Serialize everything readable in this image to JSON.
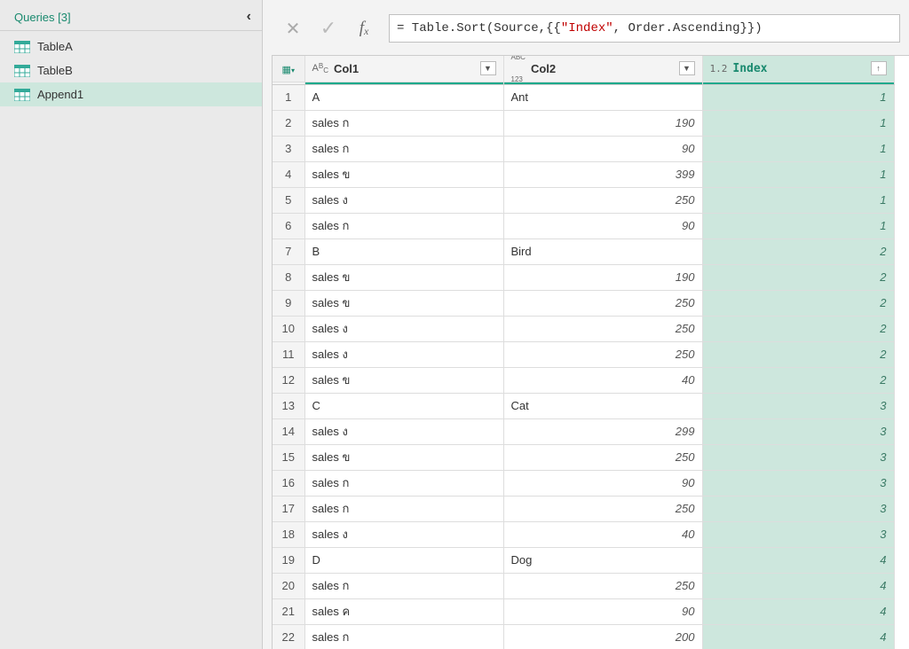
{
  "sidebar": {
    "title": "Queries [3]",
    "items": [
      {
        "label": "TableA"
      },
      {
        "label": "TableB"
      },
      {
        "label": "Append1"
      }
    ],
    "selectedIndex": 2
  },
  "formula": {
    "prefix": "= Table.Sort(Source,{{",
    "quoted": "\"Index\"",
    "suffix": ", Order.Ascending}})"
  },
  "columns": {
    "col1": {
      "type": "ABC",
      "name": "Col1"
    },
    "col2": {
      "type": "ABC123",
      "name": "Col2"
    },
    "col3": {
      "type": "1.2",
      "name": "Index",
      "sorted": "asc"
    }
  },
  "rows": [
    {
      "n": 1,
      "c1": "A",
      "c2": "Ant",
      "c2n": false,
      "idx": 1
    },
    {
      "n": 2,
      "c1": "sales ก",
      "c2": "190",
      "c2n": true,
      "idx": 1
    },
    {
      "n": 3,
      "c1": "sales ก",
      "c2": "90",
      "c2n": true,
      "idx": 1
    },
    {
      "n": 4,
      "c1": "sales ข",
      "c2": "399",
      "c2n": true,
      "idx": 1
    },
    {
      "n": 5,
      "c1": "sales ง",
      "c2": "250",
      "c2n": true,
      "idx": 1
    },
    {
      "n": 6,
      "c1": "sales ก",
      "c2": "90",
      "c2n": true,
      "idx": 1
    },
    {
      "n": 7,
      "c1": "B",
      "c2": "Bird",
      "c2n": false,
      "idx": 2
    },
    {
      "n": 8,
      "c1": "sales ข",
      "c2": "190",
      "c2n": true,
      "idx": 2
    },
    {
      "n": 9,
      "c1": "sales ข",
      "c2": "250",
      "c2n": true,
      "idx": 2
    },
    {
      "n": 10,
      "c1": "sales ง",
      "c2": "250",
      "c2n": true,
      "idx": 2
    },
    {
      "n": 11,
      "c1": "sales ง",
      "c2": "250",
      "c2n": true,
      "idx": 2
    },
    {
      "n": 12,
      "c1": "sales ข",
      "c2": "40",
      "c2n": true,
      "idx": 2
    },
    {
      "n": 13,
      "c1": "C",
      "c2": "Cat",
      "c2n": false,
      "idx": 3
    },
    {
      "n": 14,
      "c1": "sales ง",
      "c2": "299",
      "c2n": true,
      "idx": 3
    },
    {
      "n": 15,
      "c1": "sales ข",
      "c2": "250",
      "c2n": true,
      "idx": 3
    },
    {
      "n": 16,
      "c1": "sales ก",
      "c2": "90",
      "c2n": true,
      "idx": 3
    },
    {
      "n": 17,
      "c1": "sales ก",
      "c2": "250",
      "c2n": true,
      "idx": 3
    },
    {
      "n": 18,
      "c1": "sales ง",
      "c2": "40",
      "c2n": true,
      "idx": 3
    },
    {
      "n": 19,
      "c1": "D",
      "c2": "Dog",
      "c2n": false,
      "idx": 4
    },
    {
      "n": 20,
      "c1": "sales ก",
      "c2": "250",
      "c2n": true,
      "idx": 4
    },
    {
      "n": 21,
      "c1": "sales ค",
      "c2": "90",
      "c2n": true,
      "idx": 4
    },
    {
      "n": 22,
      "c1": "sales ก",
      "c2": "200",
      "c2n": true,
      "idx": 4
    }
  ]
}
